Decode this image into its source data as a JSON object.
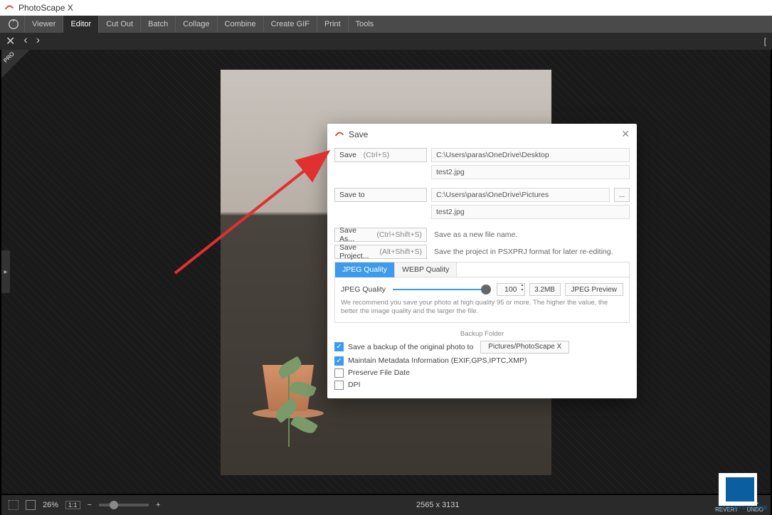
{
  "app": {
    "title": "PhotoScape X"
  },
  "menu": {
    "items": [
      "Viewer",
      "Editor",
      "Cut Out",
      "Batch",
      "Collage",
      "Combine",
      "Create GIF",
      "Print",
      "Tools"
    ],
    "active_index": 1
  },
  "canvas": {
    "dimensions": "2565 x 3131",
    "zoom_percent": "26%",
    "zoom_ratio_label": "1:1"
  },
  "bottom": {
    "revert": "REVERT",
    "undo": "UNDO"
  },
  "dialog": {
    "title": "Save",
    "save": {
      "button": "Save",
      "shortcut": "(Ctrl+S)",
      "path": "C:\\Users\\paras\\OneDrive\\Desktop",
      "filename": "test2.jpg"
    },
    "save_to": {
      "button": "Save to",
      "path": "C:\\Users\\paras\\OneDrive\\Pictures",
      "filename": "test2.jpg",
      "browse": "..."
    },
    "save_as": {
      "button": "Save As...",
      "shortcut": "(Ctrl+Shift+S)",
      "desc": "Save as a new file name."
    },
    "save_project": {
      "button": "Save Project...",
      "shortcut": "(Alt+Shift+S)",
      "desc": "Save the project in PSXPRJ format for later re-editing."
    },
    "quality": {
      "tabs": [
        "JPEG Quality",
        "WEBP Quality"
      ],
      "active_tab": 0,
      "label": "JPEG Quality",
      "value": "100",
      "size": "3.2MB",
      "preview_btn": "JPEG Preview",
      "recommend": "We recommend you save your photo at high quality 95 or more. The higher the value, the better the image quality and the larger the file."
    },
    "backup": {
      "header": "Backup Folder",
      "save_backup": {
        "label": "Save a backup of the original photo to",
        "checked": true,
        "folder": "Pictures/PhotoScape X"
      },
      "metadata": {
        "label": "Maintain Metadata Information (EXIF,GPS,IPTC,XMP)",
        "checked": true
      },
      "preserve_date": {
        "label": "Preserve File Date",
        "checked": false
      },
      "dpi": {
        "label": "DPI",
        "checked": false
      }
    }
  }
}
